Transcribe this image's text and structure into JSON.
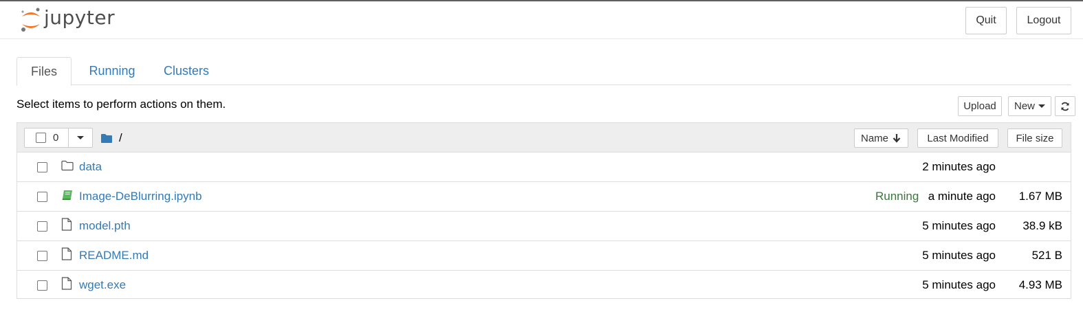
{
  "app": {
    "name": "jupyter"
  },
  "header": {
    "quit_label": "Quit",
    "logout_label": "Logout"
  },
  "tabs": [
    {
      "label": "Files",
      "active": true
    },
    {
      "label": "Running",
      "active": false
    },
    {
      "label": "Clusters",
      "active": false
    }
  ],
  "toolbar": {
    "hint": "Select items to perform actions on them.",
    "upload_label": "Upload",
    "new_label": "New",
    "refresh_icon": "refresh-icon"
  },
  "list": {
    "selected_count": "0",
    "breadcrumb": "/",
    "columns": {
      "name": "Name",
      "modified": "Last Modified",
      "size": "File size"
    },
    "rows": [
      {
        "icon": "folder-icon",
        "name": "data",
        "status": "",
        "modified": "2 minutes ago",
        "size": ""
      },
      {
        "icon": "notebook-icon",
        "name": "Image-DeBlurring.ipynb",
        "status": "Running",
        "modified": "a minute ago",
        "size": "1.67 MB"
      },
      {
        "icon": "file-icon",
        "name": "model.pth",
        "status": "",
        "modified": "5 minutes ago",
        "size": "38.9 kB"
      },
      {
        "icon": "file-icon",
        "name": "README.md",
        "status": "",
        "modified": "5 minutes ago",
        "size": "521 B"
      },
      {
        "icon": "file-icon",
        "name": "wget.exe",
        "status": "",
        "modified": "5 minutes ago",
        "size": "4.93 MB"
      }
    ]
  },
  "colors": {
    "link": "#337ab7",
    "running": "#3c763d",
    "logo_orange": "#f37726",
    "folder_blue": "#337ab7",
    "notebook_green": "#5cb85c"
  }
}
